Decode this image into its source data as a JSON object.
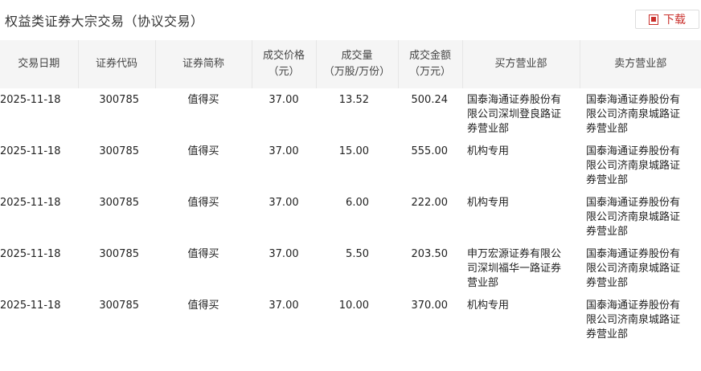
{
  "title": "权益类证券大宗交易（协议交易）",
  "download_label": "下载",
  "columns": [
    {
      "line1": "交易日期",
      "line2": ""
    },
    {
      "line1": "证券代码",
      "line2": ""
    },
    {
      "line1": "证券简称",
      "line2": ""
    },
    {
      "line1": "成交价格",
      "line2": "（元）"
    },
    {
      "line1": "成交量",
      "line2": "（万股/万份）"
    },
    {
      "line1": "成交金额",
      "line2": "（万元）"
    },
    {
      "line1": "买方营业部",
      "line2": ""
    },
    {
      "line1": "卖方营业部",
      "line2": ""
    }
  ],
  "rows": [
    {
      "date": "2025-11-18",
      "code": "300785",
      "name": "值得买",
      "price": "37.00",
      "volume": "13.52",
      "amount": "500.24",
      "buyer": "国泰海通证券股份有限公司深圳登良路证券营业部",
      "seller": "国泰海通证券股份有限公司济南泉城路证券营业部"
    },
    {
      "date": "2025-11-18",
      "code": "300785",
      "name": "值得买",
      "price": "37.00",
      "volume": "15.00",
      "amount": "555.00",
      "buyer": "机构专用",
      "seller": "国泰海通证券股份有限公司济南泉城路证券营业部"
    },
    {
      "date": "2025-11-18",
      "code": "300785",
      "name": "值得买",
      "price": "37.00",
      "volume": "6.00",
      "amount": "222.00",
      "buyer": "机构专用",
      "seller": "国泰海通证券股份有限公司济南泉城路证券营业部"
    },
    {
      "date": "2025-11-18",
      "code": "300785",
      "name": "值得买",
      "price": "37.00",
      "volume": "5.50",
      "amount": "203.50",
      "buyer": "申万宏源证券有限公司深圳福华一路证券营业部",
      "seller": "国泰海通证券股份有限公司济南泉城路证券营业部"
    },
    {
      "date": "2025-11-18",
      "code": "300785",
      "name": "值得买",
      "price": "37.00",
      "volume": "10.00",
      "amount": "370.00",
      "buyer": "机构专用",
      "seller": "国泰海通证券股份有限公司济南泉城路证券营业部"
    }
  ],
  "colors": {
    "accent": "#c9302c",
    "header_bg": "#f5f5f5"
  },
  "icons": {
    "download": "download-icon"
  }
}
